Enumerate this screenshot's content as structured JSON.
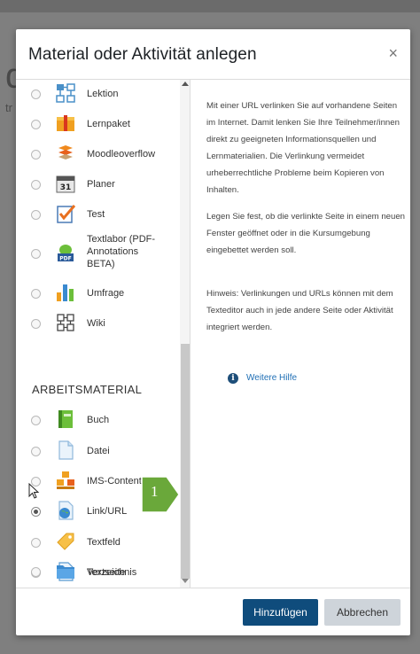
{
  "background": {
    "letter1": "d",
    "letter2": "tr"
  },
  "modal": {
    "title": "Material oder Aktivität anlegen",
    "close_label": "×"
  },
  "activities": [
    {
      "label": "Lektion",
      "icon": "lesson-icon",
      "checked": false
    },
    {
      "label": "Lernpaket",
      "icon": "package-icon",
      "checked": false
    },
    {
      "label": "Moodleoverflow",
      "icon": "moodleoverflow-icon",
      "checked": false
    },
    {
      "label": "Planer",
      "icon": "calendar-icon",
      "checked": false
    },
    {
      "label": "Test",
      "icon": "quiz-icon",
      "checked": false
    },
    {
      "label": "Textlabor (PDF-Annotations BETA)",
      "label_lines": [
        "Textlabor (PDF-",
        "Annotations",
        "BETA)"
      ],
      "icon": "pdf-icon",
      "checked": false
    },
    {
      "label": "Umfrage",
      "icon": "chart-icon",
      "checked": false
    },
    {
      "label": "Wiki",
      "icon": "wiki-icon",
      "checked": false
    }
  ],
  "section_heading": "ARBEITSMATERIAL",
  "resources": [
    {
      "label": "Buch",
      "icon": "book-icon",
      "checked": false
    },
    {
      "label": "Datei",
      "icon": "file-icon",
      "checked": false
    },
    {
      "label": "IMS-Content",
      "icon": "ims-icon",
      "checked": false
    },
    {
      "label": "Link/URL",
      "icon": "url-globe-icon",
      "checked": true
    },
    {
      "label": "Textfeld",
      "icon": "label-tag-icon",
      "checked": false
    },
    {
      "label": "Textseite",
      "icon": "page-icon",
      "checked": false
    },
    {
      "label": "Verzeichnis",
      "icon": "folder-icon",
      "checked": false
    }
  ],
  "description": {
    "p1": "Mit einer URL verlinken Sie auf vorhandene Seiten im Internet. Damit lenken Sie Ihre Teilnehmer/innen direkt zu geeigneten Informationsquellen und Lernmaterialien. Die Verlinkung vermeidet urheberrechtliche Probleme beim Kopieren von Inhalten.",
    "p2": "Legen Sie fest, ob die verlinkte Seite in einem neuen Fenster geöffnet oder in die Kursumgebung eingebettet werden soll.",
    "p3": "Hinweis: Verlinkungen und URLs können mit dem Texteditor auch in jede andere Seite oder Aktivität integriert werden.",
    "help_link": "Weitere Hilfe"
  },
  "footer": {
    "add_label": "Hinzufügen",
    "cancel_label": "Abbrechen"
  },
  "callout": {
    "number": "1"
  },
  "colors": {
    "primary": "#0f4c7c",
    "secondary": "#ced4da",
    "link": "#1f6fb5",
    "callout": "#6aa83a"
  }
}
